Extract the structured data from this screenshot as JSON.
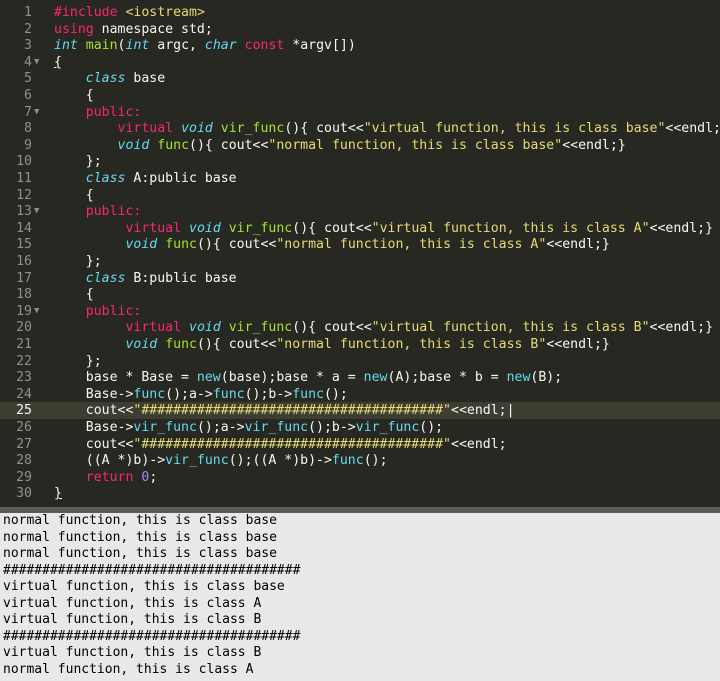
{
  "editor": {
    "lines": [
      {
        "n": "1",
        "fold": "",
        "current": false,
        "indent": "",
        "tokens": [
          {
            "t": "#include",
            "c": "t-pp"
          },
          {
            "t": " ",
            "c": "t-plain"
          },
          {
            "t": "<iostream>",
            "c": "t-str"
          }
        ]
      },
      {
        "n": "2",
        "fold": "",
        "current": false,
        "indent": "",
        "tokens": [
          {
            "t": "using",
            "c": "t-kw"
          },
          {
            "t": " namespace std;",
            "c": "t-plain"
          }
        ]
      },
      {
        "n": "3",
        "fold": "",
        "current": false,
        "indent": "",
        "tokens": [
          {
            "t": "int",
            "c": "t-type"
          },
          {
            "t": " ",
            "c": "t-plain"
          },
          {
            "t": "main",
            "c": "t-fn"
          },
          {
            "t": "(",
            "c": "t-plain"
          },
          {
            "t": "int",
            "c": "t-type"
          },
          {
            "t": " argc, ",
            "c": "t-plain"
          },
          {
            "t": "char",
            "c": "t-type"
          },
          {
            "t": " ",
            "c": "t-plain"
          },
          {
            "t": "const",
            "c": "t-kw"
          },
          {
            "t": " *argv[])",
            "c": "t-plain"
          }
        ]
      },
      {
        "n": "4",
        "fold": "▼",
        "current": false,
        "indent": "",
        "tokens": [
          {
            "t": "{",
            "c": "t-plain t-ul"
          }
        ]
      },
      {
        "n": "5",
        "fold": "",
        "current": false,
        "indent": "    ",
        "tokens": [
          {
            "t": "class",
            "c": "t-type"
          },
          {
            "t": " base",
            "c": "t-plain"
          }
        ]
      },
      {
        "n": "6",
        "fold": "",
        "current": false,
        "indent": "    ",
        "tokens": [
          {
            "t": "{",
            "c": "t-plain"
          }
        ]
      },
      {
        "n": "7",
        "fold": "▼",
        "current": false,
        "indent": "    ",
        "tokens": [
          {
            "t": "public:",
            "c": "t-kw"
          }
        ]
      },
      {
        "n": "8",
        "fold": "",
        "current": false,
        "indent": "        ",
        "tokens": [
          {
            "t": "virtual",
            "c": "t-kw"
          },
          {
            "t": " ",
            "c": "t-plain"
          },
          {
            "t": "void",
            "c": "t-type"
          },
          {
            "t": " ",
            "c": "t-plain"
          },
          {
            "t": "vir_func",
            "c": "t-fn"
          },
          {
            "t": "(){ cout<<",
            "c": "t-plain"
          },
          {
            "t": "\"virtual function, this is class base\"",
            "c": "t-str"
          },
          {
            "t": "<<endl;}",
            "c": "t-plain"
          }
        ]
      },
      {
        "n": "9",
        "fold": "",
        "current": false,
        "indent": "        ",
        "tokens": [
          {
            "t": "void",
            "c": "t-type"
          },
          {
            "t": " ",
            "c": "t-plain"
          },
          {
            "t": "func",
            "c": "t-fn"
          },
          {
            "t": "(){ cout<<",
            "c": "t-plain"
          },
          {
            "t": "\"normal function, this is class base\"",
            "c": "t-str"
          },
          {
            "t": "<<endl;}",
            "c": "t-plain"
          }
        ]
      },
      {
        "n": "10",
        "fold": "",
        "current": false,
        "indent": "    ",
        "tokens": [
          {
            "t": "};",
            "c": "t-plain"
          }
        ]
      },
      {
        "n": "11",
        "fold": "",
        "current": false,
        "indent": "    ",
        "tokens": [
          {
            "t": "class",
            "c": "t-type"
          },
          {
            "t": " A:public base",
            "c": "t-plain"
          }
        ]
      },
      {
        "n": "12",
        "fold": "",
        "current": false,
        "indent": "    ",
        "tokens": [
          {
            "t": "{",
            "c": "t-plain"
          }
        ]
      },
      {
        "n": "13",
        "fold": "▼",
        "current": false,
        "indent": "    ",
        "tokens": [
          {
            "t": "public:",
            "c": "t-kw"
          }
        ]
      },
      {
        "n": "14",
        "fold": "",
        "current": false,
        "indent": "         ",
        "tokens": [
          {
            "t": "virtual",
            "c": "t-kw"
          },
          {
            "t": " ",
            "c": "t-plain"
          },
          {
            "t": "void",
            "c": "t-type"
          },
          {
            "t": " ",
            "c": "t-plain"
          },
          {
            "t": "vir_func",
            "c": "t-fn"
          },
          {
            "t": "(){ cout<<",
            "c": "t-plain"
          },
          {
            "t": "\"virtual function, this is class A\"",
            "c": "t-str"
          },
          {
            "t": "<<endl;}",
            "c": "t-plain"
          }
        ]
      },
      {
        "n": "15",
        "fold": "",
        "current": false,
        "indent": "         ",
        "tokens": [
          {
            "t": "void",
            "c": "t-type"
          },
          {
            "t": " ",
            "c": "t-plain"
          },
          {
            "t": "func",
            "c": "t-fn"
          },
          {
            "t": "(){ cout<<",
            "c": "t-plain"
          },
          {
            "t": "\"normal function, this is class A\"",
            "c": "t-str"
          },
          {
            "t": "<<endl;}",
            "c": "t-plain"
          }
        ]
      },
      {
        "n": "16",
        "fold": "",
        "current": false,
        "indent": "    ",
        "tokens": [
          {
            "t": "};",
            "c": "t-plain"
          }
        ]
      },
      {
        "n": "17",
        "fold": "",
        "current": false,
        "indent": "    ",
        "tokens": [
          {
            "t": "class",
            "c": "t-type"
          },
          {
            "t": " B:public base",
            "c": "t-plain"
          }
        ]
      },
      {
        "n": "18",
        "fold": "",
        "current": false,
        "indent": "    ",
        "tokens": [
          {
            "t": "{",
            "c": "t-plain"
          }
        ]
      },
      {
        "n": "19",
        "fold": "▼",
        "current": false,
        "indent": "    ",
        "tokens": [
          {
            "t": "public:",
            "c": "t-kw"
          }
        ]
      },
      {
        "n": "20",
        "fold": "",
        "current": false,
        "indent": "         ",
        "tokens": [
          {
            "t": "virtual",
            "c": "t-kw"
          },
          {
            "t": " ",
            "c": "t-plain"
          },
          {
            "t": "void",
            "c": "t-type"
          },
          {
            "t": " ",
            "c": "t-plain"
          },
          {
            "t": "vir_func",
            "c": "t-fn"
          },
          {
            "t": "(){ cout<<",
            "c": "t-plain"
          },
          {
            "t": "\"virtual function, this is class B\"",
            "c": "t-str"
          },
          {
            "t": "<<endl;}",
            "c": "t-plain"
          }
        ]
      },
      {
        "n": "21",
        "fold": "",
        "current": false,
        "indent": "         ",
        "tokens": [
          {
            "t": "void",
            "c": "t-type"
          },
          {
            "t": " ",
            "c": "t-plain"
          },
          {
            "t": "func",
            "c": "t-fn"
          },
          {
            "t": "(){ cout<<",
            "c": "t-plain"
          },
          {
            "t": "\"normal function, this is class B\"",
            "c": "t-str"
          },
          {
            "t": "<<endl;}",
            "c": "t-plain"
          }
        ]
      },
      {
        "n": "22",
        "fold": "",
        "current": false,
        "indent": "    ",
        "tokens": [
          {
            "t": "};",
            "c": "t-plain"
          }
        ]
      },
      {
        "n": "23",
        "fold": "",
        "current": false,
        "indent": "    ",
        "tokens": [
          {
            "t": "base * Base = ",
            "c": "t-plain"
          },
          {
            "t": "new",
            "c": "t-fnc"
          },
          {
            "t": "(base);base * a = ",
            "c": "t-plain"
          },
          {
            "t": "new",
            "c": "t-fnc"
          },
          {
            "t": "(A);base * b = ",
            "c": "t-plain"
          },
          {
            "t": "new",
            "c": "t-fnc"
          },
          {
            "t": "(B);",
            "c": "t-plain"
          }
        ]
      },
      {
        "n": "24",
        "fold": "",
        "current": false,
        "indent": "    ",
        "tokens": [
          {
            "t": "Base->",
            "c": "t-plain"
          },
          {
            "t": "func",
            "c": "t-fnc"
          },
          {
            "t": "();a->",
            "c": "t-plain"
          },
          {
            "t": "func",
            "c": "t-fnc"
          },
          {
            "t": "();b->",
            "c": "t-plain"
          },
          {
            "t": "func",
            "c": "t-fnc"
          },
          {
            "t": "();",
            "c": "t-plain"
          }
        ]
      },
      {
        "n": "25",
        "fold": "",
        "current": true,
        "indent": "    ",
        "tokens": [
          {
            "t": "cout<<",
            "c": "t-plain"
          },
          {
            "t": "\"######################################\"",
            "c": "t-str"
          },
          {
            "t": "<<endl;|",
            "c": "t-plain"
          }
        ]
      },
      {
        "n": "26",
        "fold": "",
        "current": false,
        "indent": "    ",
        "tokens": [
          {
            "t": "Base->",
            "c": "t-plain"
          },
          {
            "t": "vir_func",
            "c": "t-fnc"
          },
          {
            "t": "();a->",
            "c": "t-plain"
          },
          {
            "t": "vir_func",
            "c": "t-fnc"
          },
          {
            "t": "();b->",
            "c": "t-plain"
          },
          {
            "t": "vir_func",
            "c": "t-fnc"
          },
          {
            "t": "();",
            "c": "t-plain"
          }
        ]
      },
      {
        "n": "27",
        "fold": "",
        "current": false,
        "indent": "    ",
        "tokens": [
          {
            "t": "cout<<",
            "c": "t-plain"
          },
          {
            "t": "\"######################################\"",
            "c": "t-str"
          },
          {
            "t": "<<endl;",
            "c": "t-plain"
          }
        ]
      },
      {
        "n": "28",
        "fold": "",
        "current": false,
        "indent": "    ",
        "tokens": [
          {
            "t": "((A *)b)->",
            "c": "t-plain"
          },
          {
            "t": "vir_func",
            "c": "t-fnc"
          },
          {
            "t": "();((A *)b)->",
            "c": "t-plain"
          },
          {
            "t": "func",
            "c": "t-fnc"
          },
          {
            "t": "();",
            "c": "t-plain"
          }
        ]
      },
      {
        "n": "29",
        "fold": "",
        "current": false,
        "indent": "    ",
        "tokens": [
          {
            "t": "return",
            "c": "t-kw"
          },
          {
            "t": " ",
            "c": "t-plain"
          },
          {
            "t": "0",
            "c": "t-num"
          },
          {
            "t": ";",
            "c": "t-plain"
          }
        ]
      },
      {
        "n": "30",
        "fold": "",
        "current": false,
        "indent": "",
        "tokens": [
          {
            "t": "}",
            "c": "t-plain t-ul"
          }
        ]
      }
    ]
  },
  "console": {
    "lines": [
      "normal function, this is class base",
      "normal function, this is class base",
      "normal function, this is class base",
      "######################################",
      "virtual function, this is class base",
      "virtual function, this is class A",
      "virtual function, this is class B",
      "######################################",
      "virtual function, this is class B",
      "normal function, this is class A"
    ]
  },
  "colors": {
    "editor_bg": "#272822",
    "keyword": "#f92672",
    "type": "#66d9ef",
    "string": "#e6db74",
    "function": "#a6e22e",
    "number": "#ae81ff",
    "console_bg": "#e8e8e8"
  }
}
